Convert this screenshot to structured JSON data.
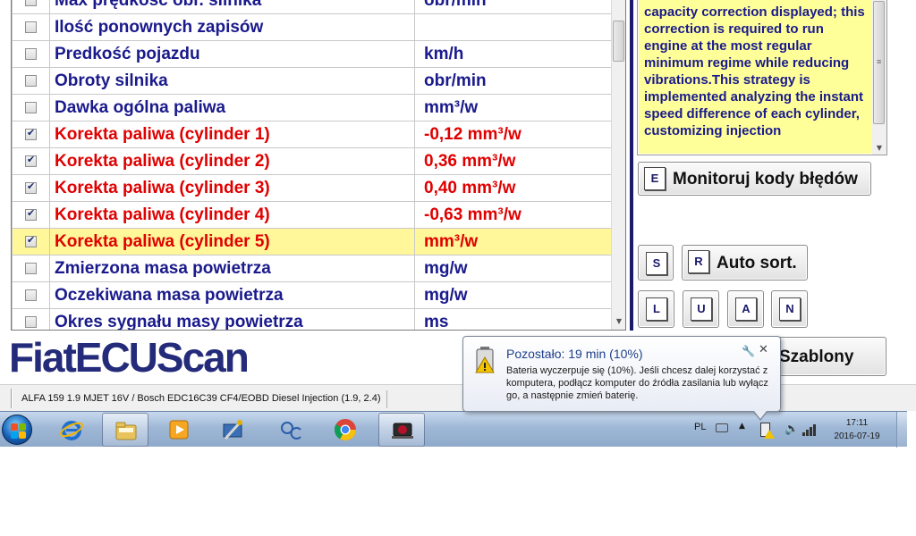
{
  "table": {
    "rows": [
      {
        "name": "Max prędkość obr. silnika",
        "value": "obr/min",
        "checked": false,
        "active": false,
        "highlight": false
      },
      {
        "name": "Ilość ponownych zapisów",
        "value": "",
        "checked": false,
        "active": false,
        "highlight": false
      },
      {
        "name": "Predkość pojazdu",
        "value": "km/h",
        "checked": false,
        "active": false,
        "highlight": false
      },
      {
        "name": "Obroty silnika",
        "value": "obr/min",
        "checked": false,
        "active": false,
        "highlight": false
      },
      {
        "name": "Dawka ogólna paliwa",
        "value": "mm³/w",
        "checked": false,
        "active": false,
        "highlight": false
      },
      {
        "name": "Korekta paliwa (cylinder 1)",
        "value": "-0,12 mm³/w",
        "checked": true,
        "active": true,
        "highlight": false
      },
      {
        "name": "Korekta paliwa (cylinder 2)",
        "value": "0,36 mm³/w",
        "checked": true,
        "active": true,
        "highlight": false
      },
      {
        "name": "Korekta paliwa (cylinder 3)",
        "value": "0,40 mm³/w",
        "checked": true,
        "active": true,
        "highlight": false
      },
      {
        "name": "Korekta paliwa (cylinder 4)",
        "value": "-0,63 mm³/w",
        "checked": true,
        "active": true,
        "highlight": false
      },
      {
        "name": "Korekta paliwa (cylinder 5)",
        "value": "mm³/w",
        "checked": true,
        "active": true,
        "highlight": true
      },
      {
        "name": "Zmierzona masa powietrza",
        "value": "mg/w",
        "checked": false,
        "active": false,
        "highlight": false
      },
      {
        "name": "Oczekiwana masa powietrza",
        "value": "mg/w",
        "checked": false,
        "active": false,
        "highlight": false
      },
      {
        "name": "Okres sygnału masy powietrza",
        "value": "ms",
        "checked": false,
        "active": false,
        "highlight": false
      }
    ]
  },
  "info": {
    "text": "capacity correction displayed; this correction is required to run engine at the most regular minimum regime while reducing vibrations.This strategy is implemented analyzing the instant speed difference of each cylinder, customizing injection"
  },
  "buttons": {
    "monitor": {
      "key": "E",
      "label": "Monitoruj kody błędów"
    },
    "s": {
      "key": "S"
    },
    "autosort": {
      "key": "R",
      "label": "Auto sort."
    },
    "l": {
      "key": "L"
    },
    "u": {
      "key": "U"
    },
    "a": {
      "key": "A"
    },
    "n": {
      "key": "N"
    },
    "szablony": {
      "label": "Szablony"
    }
  },
  "logo": {
    "text": "FiatECUScan"
  },
  "statusbar": {
    "vehicle": "ALFA 159 1.9 MJET 16V / Bosch EDC16C39 CF4/EOBD Diesel Injection (1.9, 2.4)"
  },
  "notification": {
    "title": "Pozostało: 19 min (10%)",
    "body": "Bateria wyczerpuje się (10%). Jeśli chcesz dalej korzystać z komputera, podłącz komputer do źródła zasilania lub wyłącz go, a następnie zmień baterię."
  },
  "tray": {
    "language": "PL",
    "time": "17:11",
    "date": "2016-07-19"
  },
  "taskbar": {
    "icons": [
      "start-orb",
      "internet-explorer-icon",
      "file-explorer-icon",
      "media-player-icon",
      "pin-app-icon",
      "oc-app-icon",
      "chrome-icon",
      "fiat-ecu-scan-icon"
    ]
  },
  "colors": {
    "label_blue": "#1a1a8c",
    "active_red": "#e00000",
    "highlight_yellow": "#fff79a",
    "info_yellow": "#ffff99"
  }
}
